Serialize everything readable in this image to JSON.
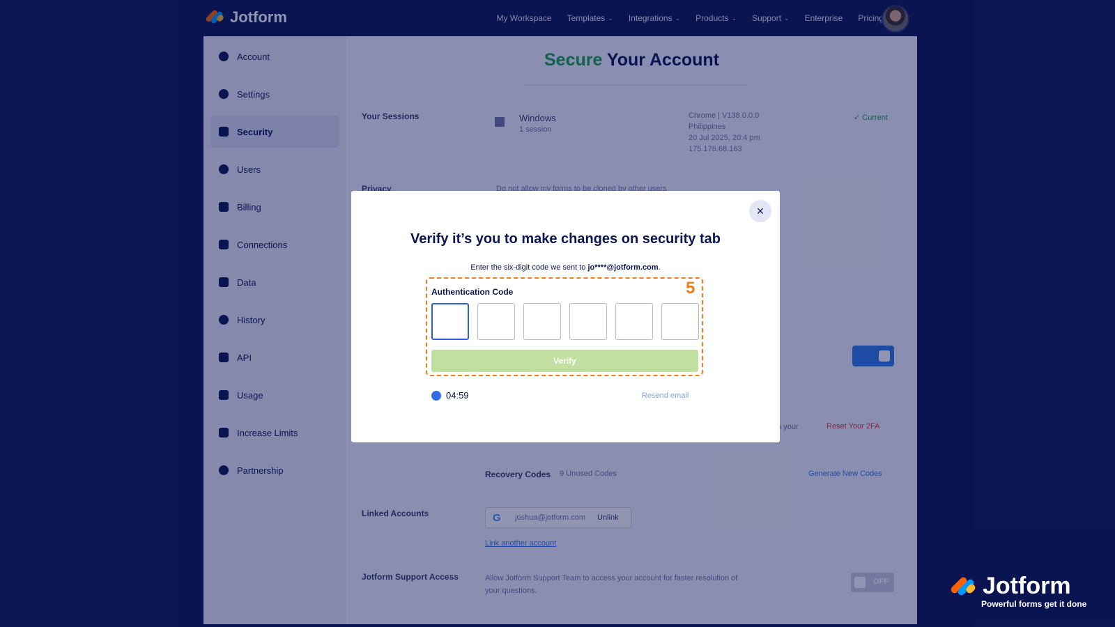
{
  "brand": {
    "name": "Jotform"
  },
  "topnav": {
    "items": [
      {
        "label": "My Workspace",
        "has_menu": false
      },
      {
        "label": "Templates",
        "has_menu": true
      },
      {
        "label": "Integrations",
        "has_menu": true
      },
      {
        "label": "Products",
        "has_menu": true
      },
      {
        "label": "Support",
        "has_menu": true
      },
      {
        "label": "Enterprise",
        "has_menu": false
      },
      {
        "label": "Pricing",
        "has_menu": false
      }
    ]
  },
  "sidebar": {
    "items": [
      {
        "label": "Account",
        "icon": "user-icon"
      },
      {
        "label": "Settings",
        "icon": "gear-icon"
      },
      {
        "label": "Security",
        "icon": "lock-icon",
        "active": true
      },
      {
        "label": "Users",
        "icon": "users-icon"
      },
      {
        "label": "Billing",
        "icon": "billing-icon"
      },
      {
        "label": "Connections",
        "icon": "plug-icon"
      },
      {
        "label": "Data",
        "icon": "database-icon"
      },
      {
        "label": "History",
        "icon": "history-icon"
      },
      {
        "label": "API",
        "icon": "api-icon"
      },
      {
        "label": "Usage",
        "icon": "chart-icon"
      },
      {
        "label": "Increase Limits",
        "icon": "gift-icon"
      },
      {
        "label": "Partnership",
        "icon": "handshake-icon"
      }
    ]
  },
  "page": {
    "title_accent": "Secure",
    "title_rest": " Your Account",
    "sessions_label": "Your Sessions",
    "session_os": "Windows",
    "session_count": "1 session",
    "session_browser": "Chrome | V138.0.0.0",
    "session_country": "Philippines",
    "session_time": "20 Jul 2025, 20:4 pm",
    "session_ip": "175.176.68.163",
    "session_current": "Current",
    "privacy_label": "Privacy",
    "privacy_text": "Do not allow my forms to be cloned by other users",
    "reset_2fa": "Reset Your 2FA",
    "on_your": "on your",
    "recovery_label": "Recovery Codes",
    "recovery_count": "9 Unused Codes",
    "generate_codes": "Generate New Codes",
    "linked_label": "Linked Accounts",
    "linked_email": "joshua@jotform.com",
    "unlink": "Unlink",
    "link_another": "Link another account",
    "support_label": "Jotform Support Access",
    "support_text_1": "Allow Jotform Support Team to access your account for faster resolution of",
    "support_text_2": "your questions.",
    "support_toggle": "OFF"
  },
  "modal": {
    "close": "×",
    "title": "Verify it’s you to make changes on security tab",
    "sub_prefix": "Enter the six-digit code we sent to ",
    "sub_email": "jo****@jotform.com",
    "sub_suffix": ".",
    "step": "5",
    "auth_label": "Authentication Code",
    "verify": "Verify",
    "timer": "04:59",
    "resend": "Resend email"
  },
  "watermark": {
    "name": "Jotform",
    "tagline": "Powerful forms get it done"
  }
}
